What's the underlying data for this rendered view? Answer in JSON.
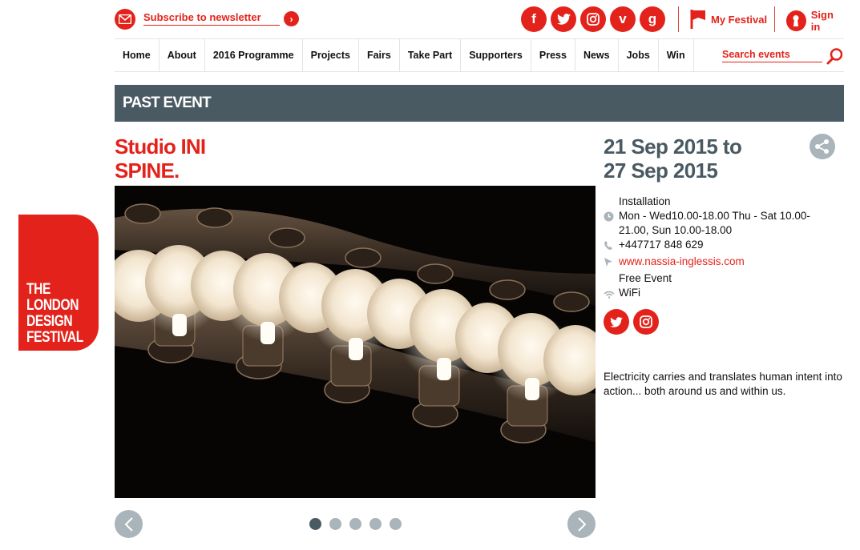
{
  "logo": {
    "text": "THE\nLONDON\nDESIGN\nFESTIVAL"
  },
  "topbar": {
    "newsletter_label": "Subscribe to newsletter",
    "social_icons": [
      "facebook-icon",
      "twitter-icon",
      "instagram-icon",
      "vimeo-icon",
      "google-plus-icon"
    ],
    "my_festival_label": "My Festival",
    "sign_in_label": "Sign in"
  },
  "nav": {
    "items": [
      "Home",
      "About",
      "2016 Programme",
      "Projects",
      "Fairs",
      "Take Part",
      "Supporters",
      "Press",
      "News",
      "Jobs",
      "Win"
    ],
    "search_placeholder": "Search events"
  },
  "banner": {
    "label": "PAST EVENT"
  },
  "event": {
    "title_line1": "Studio INI",
    "title_line2": "SPINE.",
    "date_line1": "21 Sep 2015 to",
    "date_line2": "27 Sep 2015",
    "type": "Installation",
    "hours": "Mon - Wed10.00-18.00 Thu - Sat 10.00-21.00, Sun 10.00-18.00",
    "phone": "+447717 848 629",
    "website": "www.nassia-inglessis.com",
    "price": "Free Event",
    "wifi": "WiFi",
    "social_icons": [
      "twitter-icon",
      "instagram-icon"
    ],
    "description": "Electricity carries and translates human intent into action... both around us and within us."
  },
  "carousel": {
    "slide_count": 5,
    "active_index": 0
  },
  "colors": {
    "brand_red": "#e3231b",
    "slate": "#4a5a62",
    "muted": "#aab4bb"
  }
}
